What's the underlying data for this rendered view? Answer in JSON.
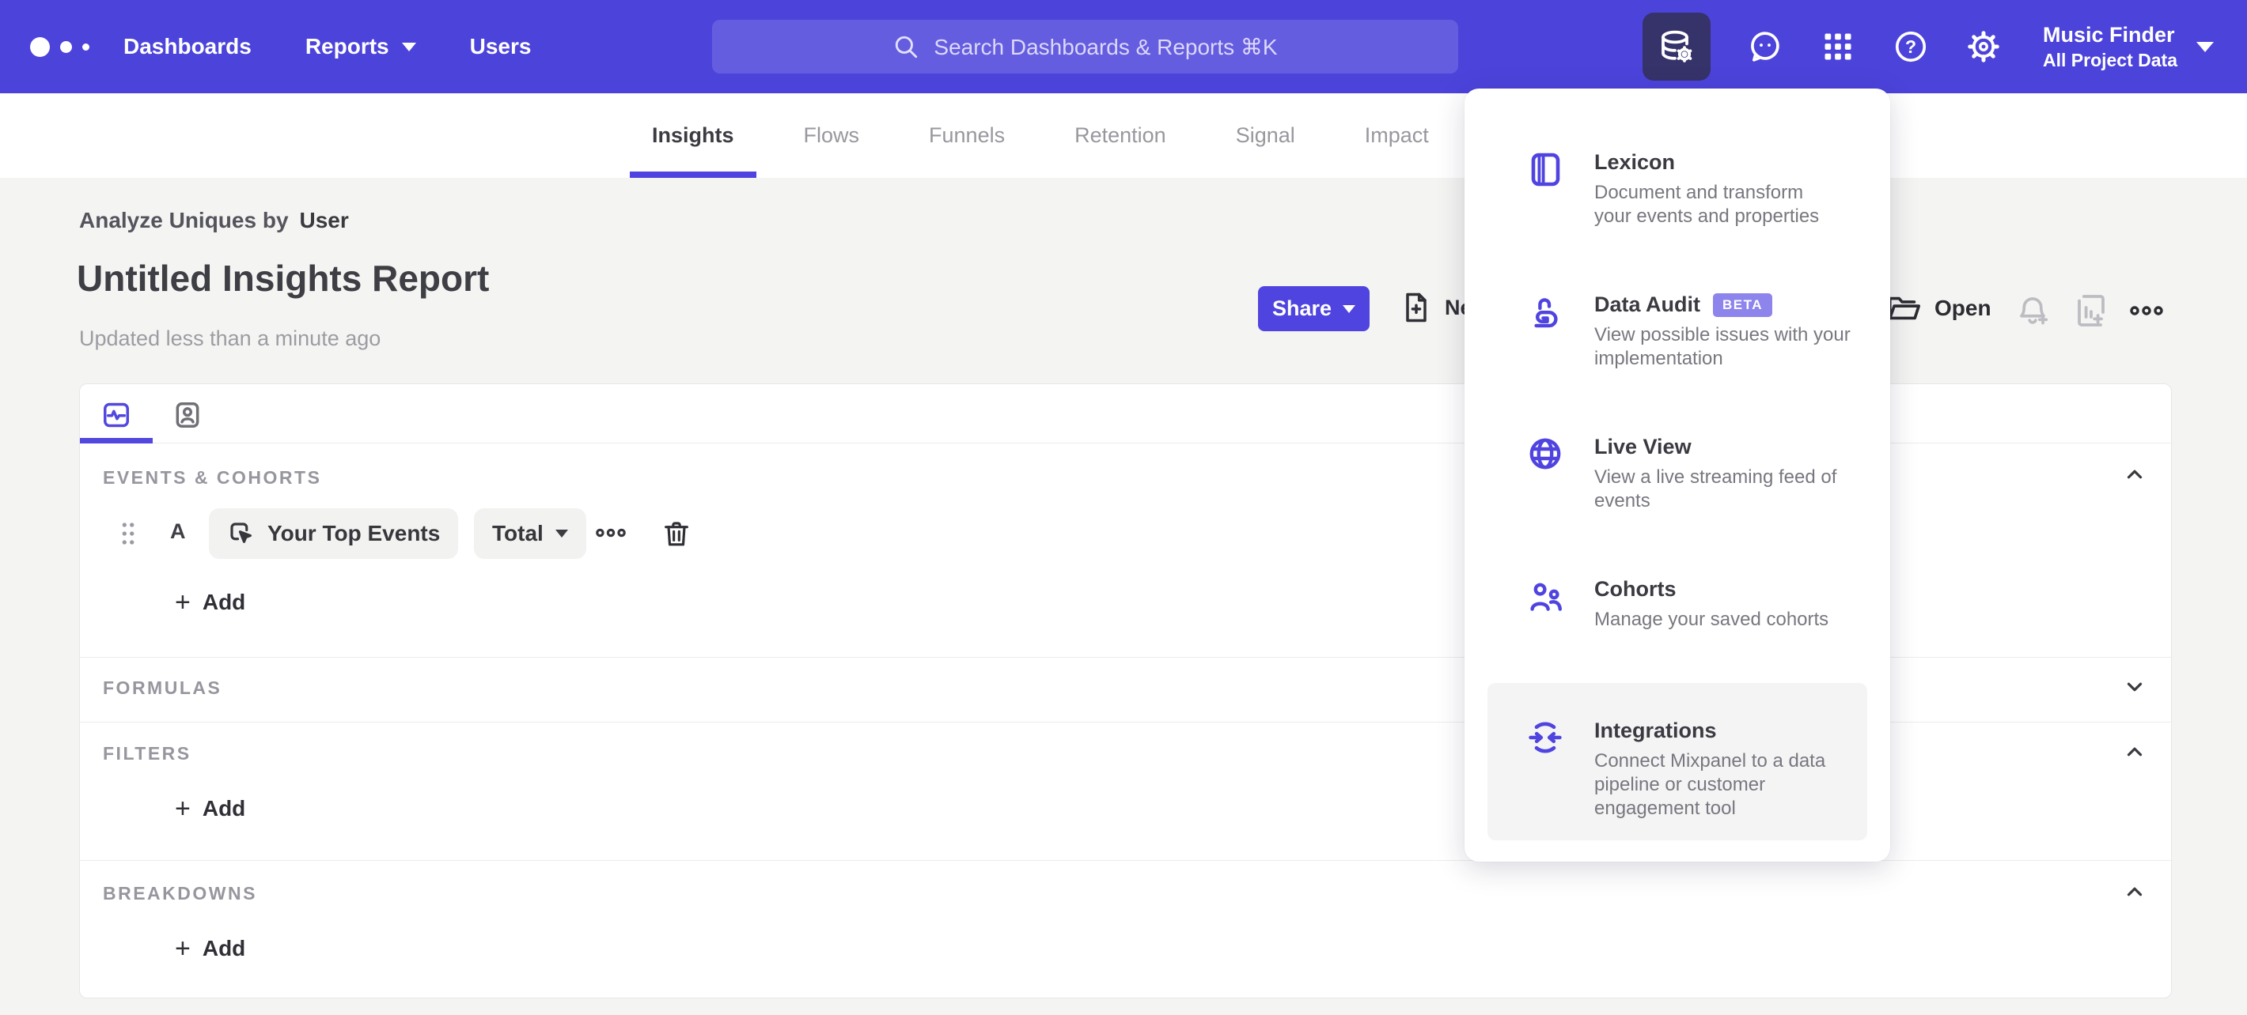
{
  "nav": {
    "items": [
      {
        "label": "Dashboards"
      },
      {
        "label": "Reports"
      },
      {
        "label": "Users"
      }
    ],
    "search_placeholder": "Search Dashboards & Reports ⌘K",
    "project": {
      "name": "Music Finder",
      "scope": "All Project Data"
    }
  },
  "tabs": {
    "items": [
      "Insights",
      "Flows",
      "Funnels",
      "Retention",
      "Signal",
      "Impact"
    ],
    "active": "Insights"
  },
  "report": {
    "analyze_prefix": "Analyze Uniques by",
    "analyze_value": "User",
    "title": "Untitled Insights Report",
    "updated": "Updated less than a minute ago",
    "share_label": "Share",
    "new_label": "New",
    "open_label": "Open"
  },
  "builder": {
    "events": {
      "label": "EVENTS & COHORTS",
      "row_letter": "A",
      "event_name": "Your Top Events",
      "metric": "Total",
      "add_label": "Add"
    },
    "formulas": {
      "label": "FORMULAS"
    },
    "filters": {
      "label": "FILTERS",
      "add_label": "Add"
    },
    "breakdowns": {
      "label": "BREAKDOWNS",
      "add_label": "Add"
    }
  },
  "data_menu": {
    "items": [
      {
        "title": "Lexicon",
        "description": "Document and transform your events and properties"
      },
      {
        "title": "Data Audit",
        "badge": "BETA",
        "description": "View possible issues with your implementation"
      },
      {
        "title": "Live View",
        "description": "View a live streaming feed of events"
      },
      {
        "title": "Cohorts",
        "description": "Manage your saved cohorts"
      },
      {
        "title": "Integrations",
        "description": "Connect Mixpanel to a data pipeline or customer engagement tool"
      }
    ]
  },
  "colors": {
    "nav": "#4c43db",
    "accent": "#4f44e0",
    "active_icon_bg": "#36326a",
    "beta_badge": "#8d84ec",
    "page_bg": "#f4f4f2"
  }
}
